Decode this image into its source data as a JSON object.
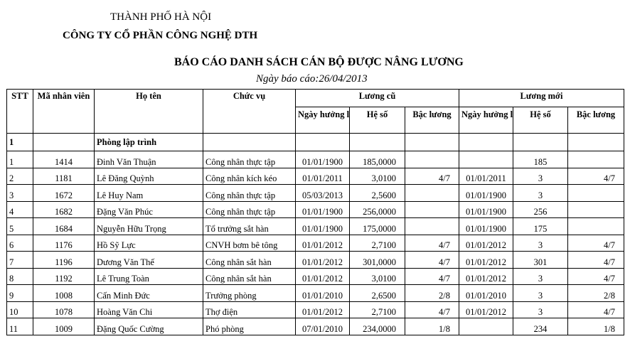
{
  "header": {
    "city": "THÀNH PHỐ HÀ NỘI",
    "company": "CÔNG TY CỔ PHẦN CÔNG NGHỆ DTH",
    "title": "BÁO CÁO DANH SÁCH CÁN BỘ ĐƯỢC NÂNG LƯƠNG",
    "report_date": "Ngày báo cáo:26/04/2013"
  },
  "columns": {
    "stt": "STT",
    "employee_id": "Mã nhân viên",
    "full_name": "Họ tên",
    "position": "Chức vụ",
    "old_salary": "Lương cũ",
    "new_salary": "Lương mới",
    "effective_date": "Ngày hưởng lương",
    "coefficient": "Hệ số",
    "grade": "Bậc lương"
  },
  "group": {
    "stt": "1",
    "name": "Phòng lập trình"
  },
  "rows": [
    {
      "stt": "1",
      "id": "1414",
      "name": "Đinh Văn Thuận",
      "position": "Công nhân thực tập",
      "old_date": "01/01/1900",
      "old_coef": "185,0000",
      "old_grade": "",
      "new_date": "",
      "new_coef": "185",
      "new_grade": ""
    },
    {
      "stt": "2",
      "id": "1181",
      "name": "Lê Đăng Quỳnh",
      "position": "Công nhân kích kéo",
      "old_date": "01/01/2011",
      "old_coef": "3,0100",
      "old_grade": "4/7",
      "new_date": "01/01/2011",
      "new_coef": "3",
      "new_grade": "4/7"
    },
    {
      "stt": "3",
      "id": "1672",
      "name": "Lê Huy Nam",
      "position": "Công nhân thực tập",
      "old_date": "05/03/2013",
      "old_coef": "2,5600",
      "old_grade": "",
      "new_date": "01/01/1900",
      "new_coef": "3",
      "new_grade": ""
    },
    {
      "stt": "4",
      "id": "1682",
      "name": "Đặng Văn Phúc",
      "position": "Công nhân thực tập",
      "old_date": "01/01/1900",
      "old_coef": "256,0000",
      "old_grade": "",
      "new_date": "01/01/1900",
      "new_coef": "256",
      "new_grade": ""
    },
    {
      "stt": "5",
      "id": "1684",
      "name": "Nguyễn Hữu Trọng",
      "position": "Tổ trưởng sắt hàn",
      "old_date": "01/01/1900",
      "old_coef": "175,0000",
      "old_grade": "",
      "new_date": "01/01/1900",
      "new_coef": "175",
      "new_grade": ""
    },
    {
      "stt": "6",
      "id": "1176",
      "name": "Hồ Sỹ Lực",
      "position": "CNVH bơm bê tông",
      "old_date": "01/01/2012",
      "old_coef": "2,7100",
      "old_grade": "4/7",
      "new_date": "01/01/2012",
      "new_coef": "3",
      "new_grade": "4/7"
    },
    {
      "stt": "7",
      "id": "1196",
      "name": "Dương Văn Thế",
      "position": "Công nhân sắt hàn",
      "old_date": "01/01/2012",
      "old_coef": "301,0000",
      "old_grade": "4/7",
      "new_date": "01/01/2012",
      "new_coef": "301",
      "new_grade": "4/7"
    },
    {
      "stt": "8",
      "id": "1192",
      "name": "Lê Trung Toàn",
      "position": "Công nhân sắt hàn",
      "old_date": "01/01/2012",
      "old_coef": "3,0100",
      "old_grade": "4/7",
      "new_date": "01/01/2012",
      "new_coef": "3",
      "new_grade": "4/7"
    },
    {
      "stt": "9",
      "id": "1008",
      "name": "Cấn Minh Đức",
      "position": "Trưởng phòng",
      "old_date": "01/01/2010",
      "old_coef": "2,6500",
      "old_grade": "2/8",
      "new_date": "01/01/2010",
      "new_coef": "3",
      "new_grade": "2/8"
    },
    {
      "stt": "10",
      "id": "1078",
      "name": "Hoàng Văn Chi",
      "position": "Thợ điện",
      "old_date": "01/01/2012",
      "old_coef": "2,7100",
      "old_grade": "4/7",
      "new_date": "01/01/2012",
      "new_coef": "3",
      "new_grade": "4/7"
    },
    {
      "stt": "11",
      "id": "1009",
      "name": "Đặng Quốc Cường",
      "position": "Phó phòng",
      "old_date": "07/01/2010",
      "old_coef": "234,0000",
      "old_grade": "1/8",
      "new_date": "",
      "new_coef": "234",
      "new_grade": "1/8"
    }
  ]
}
